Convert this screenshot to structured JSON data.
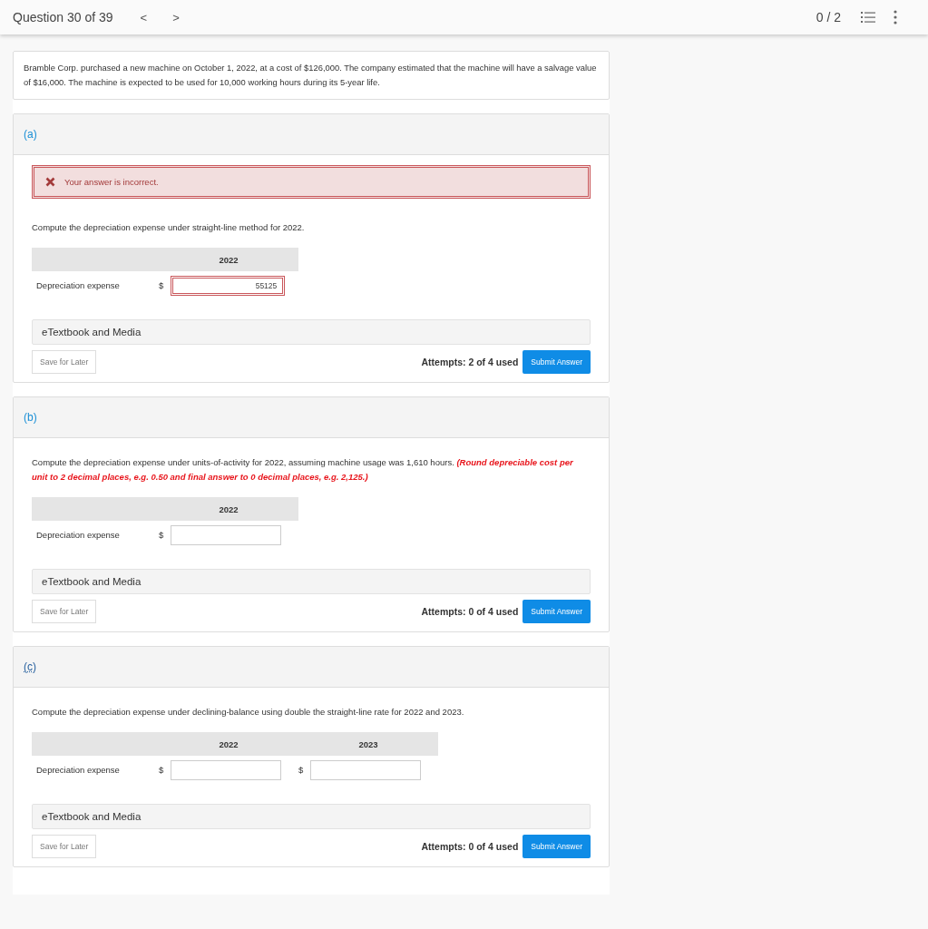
{
  "header": {
    "title": "Question 30 of 39",
    "prev": "<",
    "next": ">",
    "score": "0 / 2"
  },
  "intro": "Bramble Corp. purchased a new machine on October 1, 2022, at a cost of $126,000. The company estimated that the machine will have a salvage value of $16,000. The machine is expected to be used for 10,000 working hours during its 5-year life.",
  "parts": [
    {
      "label": "(a)",
      "focused": false,
      "feedback": "Your answer is incorrect.",
      "prompt": "Compute the depreciation expense under straight-line method for 2022.",
      "columns": [
        "2022"
      ],
      "row_label": "Depreciation expense",
      "inputs": [
        {
          "currency": "$",
          "value": "55125",
          "error": true
        }
      ],
      "media": "eTextbook and Media",
      "save": "Save for Later",
      "attempts": "Attempts: 2 of 4 used",
      "submit": "Submit Answer"
    },
    {
      "label": "(b)",
      "focused": false,
      "prompt": "Compute the depreciation expense under units-of-activity for 2022, assuming machine usage was 1,610 hours.",
      "note": "(Round depreciable cost per unit to 2 decimal places, e.g. 0.50 and final answer to 0 decimal places, e.g. 2,125.)",
      "columns": [
        "2022"
      ],
      "row_label": "Depreciation expense",
      "inputs": [
        {
          "currency": "$",
          "error": false
        }
      ],
      "media": "eTextbook and Media",
      "save": "Save for Later",
      "attempts": "Attempts: 0 of 4 used",
      "submit": "Submit Answer"
    },
    {
      "label": "(c)",
      "focused": true,
      "prompt": "Compute the depreciation expense under declining-balance using double the straight-line rate for 2022 and 2023.",
      "columns": [
        "2022",
        "2023"
      ],
      "row_label": "Depreciation expense",
      "inputs": [
        {
          "currency": "$",
          "error": false
        },
        {
          "currency": "$",
          "error": false
        }
      ],
      "media": "eTextbook and Media",
      "save": "Save for Later",
      "attempts": "Attempts: 0 of 4 used",
      "submit": "Submit Answer"
    }
  ]
}
